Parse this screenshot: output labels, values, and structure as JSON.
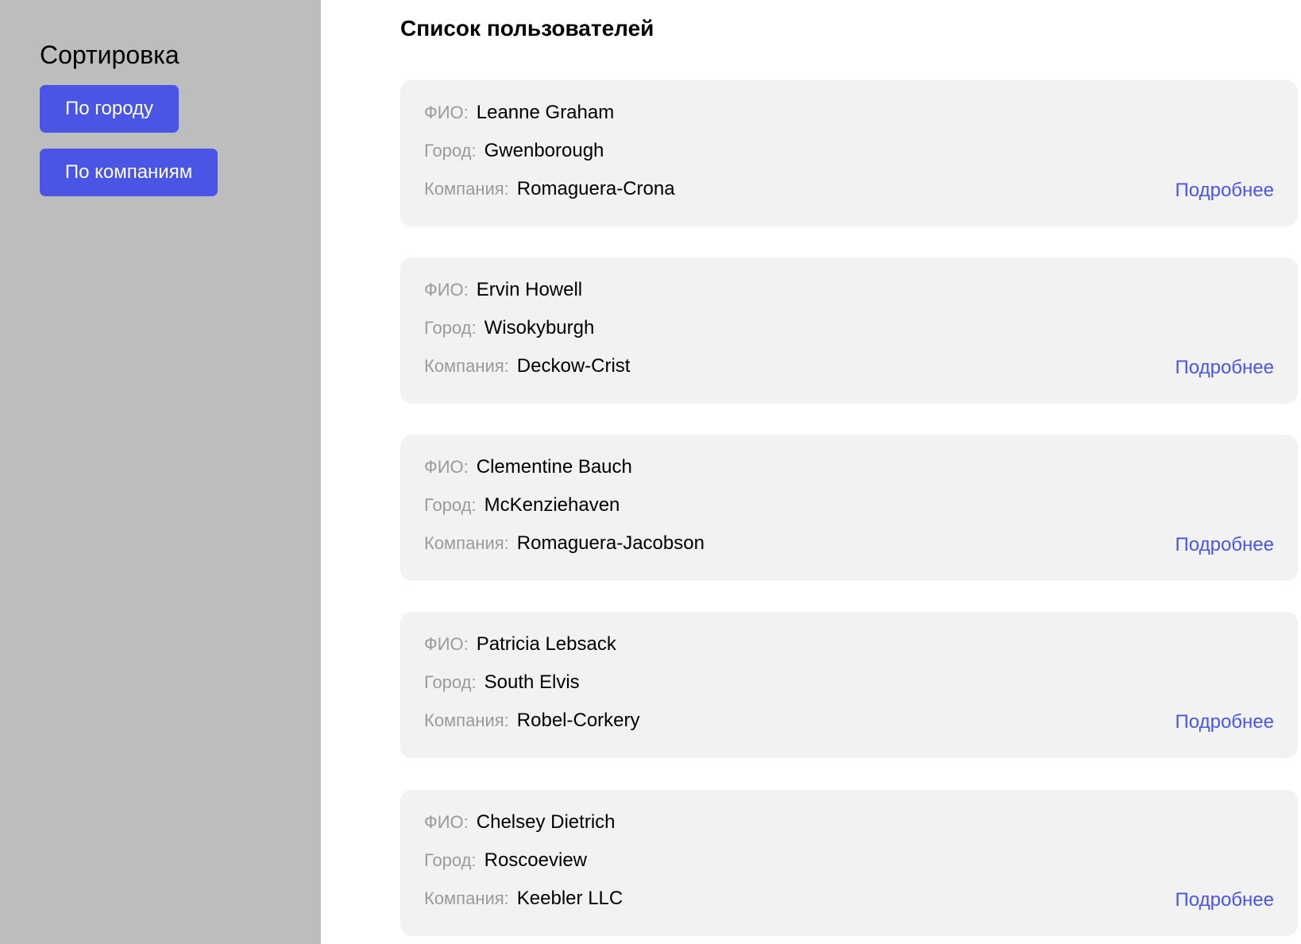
{
  "sidebar": {
    "title": "Сортировка",
    "buttons": [
      {
        "label": "По городу"
      },
      {
        "label": "По компаниям"
      }
    ]
  },
  "main": {
    "title": "Список пользователей",
    "field_labels": {
      "name": "ФИО:",
      "city": "Город:",
      "company": "Компания:"
    },
    "more_label": "Подробнее",
    "users": [
      {
        "name": "Leanne Graham",
        "city": "Gwenborough",
        "company": "Romaguera-Crona"
      },
      {
        "name": "Ervin Howell",
        "city": "Wisokyburgh",
        "company": "Deckow-Crist"
      },
      {
        "name": "Clementine Bauch",
        "city": "McKenziehaven",
        "company": "Romaguera-Jacobson"
      },
      {
        "name": "Patricia Lebsack",
        "city": "South Elvis",
        "company": "Robel-Corkery"
      },
      {
        "name": "Chelsey Dietrich",
        "city": "Roscoeview",
        "company": "Keebler LLC"
      }
    ]
  },
  "colors": {
    "accent": "#4a55e6",
    "sidebar_bg": "#bdbdbd",
    "card_bg": "#f2f2f2",
    "label_gray": "#9a9a9a"
  }
}
